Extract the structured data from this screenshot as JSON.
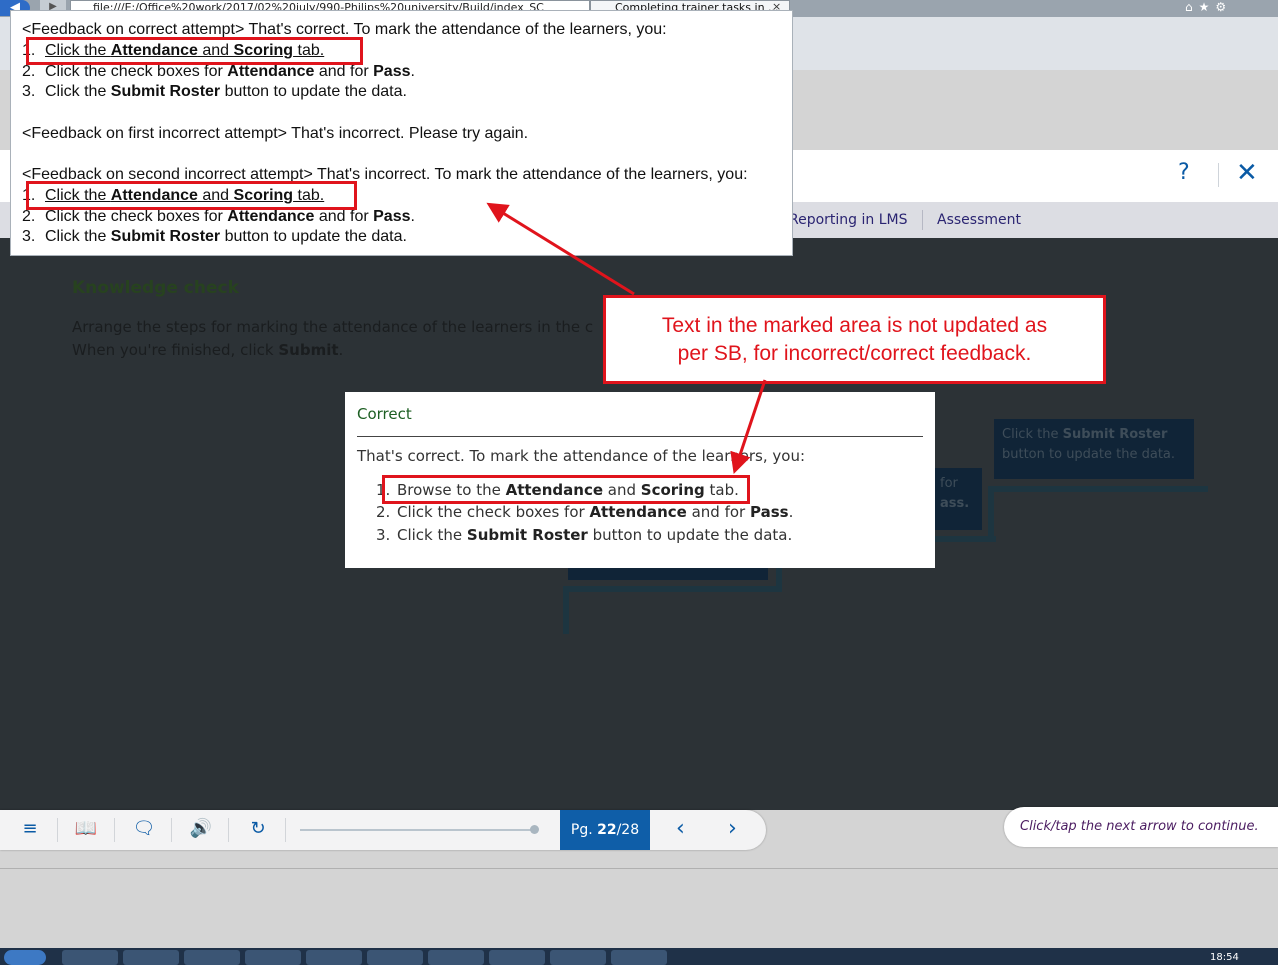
{
  "browser": {
    "address": "file:///E:/Office%20work/2017/02%20july/990-Philips%20university/Build/index_SC",
    "tab_title": "Completing trainer tasks in ...",
    "tab_close": "×"
  },
  "header": {
    "help": "?",
    "close": "✕"
  },
  "nav": {
    "tabs": [
      "Reporting in LMS",
      "Assessment"
    ]
  },
  "knowledge_check": {
    "title": "Knowledge check",
    "instruction_line1": "Arrange the steps for marking the attendance of the learners in the c",
    "instruction_line2_prefix": "When you're finished, click ",
    "instruction_line2_bold": "Submit",
    "instruction_line2_suffix": ".",
    "step_box_1_prefix": "Click the ",
    "step_box_1_bold": "Submit Roster",
    "step_box_1_suffix": " button to update the data.",
    "step_box_2_a": "for",
    "step_box_2_b": "ass."
  },
  "popup": {
    "title": "Correct",
    "intro": "That's correct. To mark the attendance of the learners, you:",
    "steps": [
      {
        "num": "1.",
        "pre": "Browse to the ",
        "b1": "Attendance",
        "mid": " and ",
        "b2": "Scoring",
        "post": " tab."
      },
      {
        "num": "2.",
        "pre": "Click the check boxes for ",
        "b1": "Attendance",
        "mid": " and for ",
        "b2": "Pass",
        "post": "."
      },
      {
        "num": "3.",
        "pre": "Click the ",
        "b1": "Submit Roster",
        "mid": " button to update the data.",
        "b2": "",
        "post": ""
      }
    ]
  },
  "toolbar": {
    "menu_icon": "≡",
    "page_label": "Pg. ",
    "page_current": "22",
    "page_total": "/28",
    "prev": "‹",
    "next": "›"
  },
  "continue_hint": "Click/tap the next arrow to continue.",
  "taskbar": {
    "clock": "18:54"
  },
  "doc_snippet": {
    "correct_header": "<Feedback on correct attempt> That's correct. To mark the attendance of the learners, you:",
    "first_incorrect": "<Feedback on first incorrect attempt> That's incorrect. Please try again.",
    "second_incorrect_header": "<Feedback on second incorrect attempt> That's incorrect. To mark the attendance of the learners, you:",
    "steps": [
      {
        "num": "1.",
        "pre": "Click the ",
        "b1": "Attendance",
        "mid": " and ",
        "b2": "Scoring",
        "post": " tab."
      },
      {
        "num": "2.",
        "pre": "Click the check boxes for ",
        "b1": "Attendance",
        "mid": " and for ",
        "b2": "Pass",
        "post": "."
      },
      {
        "num": "3.",
        "pre": "Click the ",
        "b1": "Submit Roster",
        "mid": " button to update the data.",
        "b2": "",
        "post": ""
      }
    ]
  },
  "callout": {
    "line1": "Text in the marked area is not updated as",
    "line2": "per SB, for incorrect/correct feedback."
  },
  "colors": {
    "annotation_red": "#e0141c",
    "brand_blue": "#0f5ea8",
    "content_dark": "#2c3236"
  }
}
